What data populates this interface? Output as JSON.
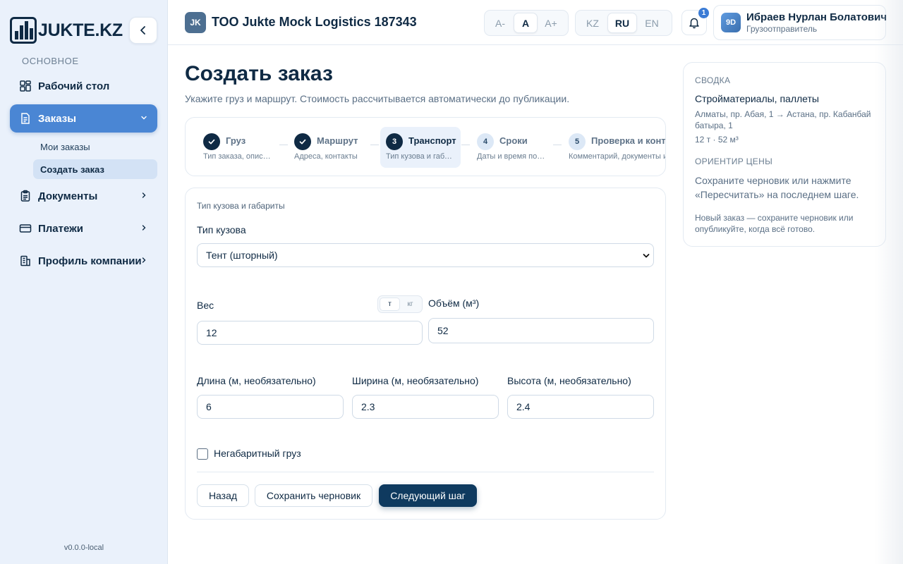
{
  "brand": {
    "logo_text": "JUKTE.KZ"
  },
  "sidebar": {
    "section_label": "ОСНОВНОЕ",
    "items": [
      {
        "label": "Рабочий стол",
        "icon": "dashboard-icon"
      },
      {
        "label": "Заказы",
        "icon": "document-icon",
        "active": true
      },
      {
        "label": "Документы",
        "icon": "clipboard-icon"
      },
      {
        "label": "Платежи",
        "icon": "card-icon"
      },
      {
        "label": "Профиль компании",
        "icon": "building-icon"
      }
    ],
    "sub_items": [
      {
        "label": "Мои заказы"
      },
      {
        "label": "Создать заказ",
        "active": true
      }
    ],
    "version": "v0.0.0-local"
  },
  "header": {
    "company_badge": "JK",
    "company_name": "ТОО Jukte Mock Logistics 187343",
    "font_size": [
      "A-",
      "A",
      "A+"
    ],
    "font_size_selected": "A",
    "languages": [
      "KZ",
      "RU",
      "EN"
    ],
    "language_selected": "RU",
    "notifications_count": "1",
    "user": {
      "initials": "9D",
      "name": "Ибраев Нурлан Болатович",
      "role": "Грузоотправитель"
    }
  },
  "page": {
    "title": "Создать заказ",
    "subtitle": "Укажите груз и маршрут. Стоимость рассчитывается автоматически до публикации."
  },
  "steps": [
    {
      "num": "1",
      "title": "Груз",
      "desc": "Тип заказа, описание",
      "status": "done"
    },
    {
      "num": "2",
      "title": "Маршрут",
      "desc": "Адреса, контакты",
      "status": "done"
    },
    {
      "num": "3",
      "title": "Транспорт",
      "desc": "Тип кузова и габариты",
      "status": "current"
    },
    {
      "num": "4",
      "title": "Сроки",
      "desc": "Даты и время погрузки",
      "status": "todo"
    },
    {
      "num": "5",
      "title": "Проверка и контакты",
      "desc": "Комментарий, документы и",
      "status": "todo"
    }
  ],
  "form": {
    "section_title": "Тип кузова и габариты",
    "body_type_label": "Тип кузова",
    "body_type_value": "Тент (шторный)",
    "weight_label": "Вес",
    "weight_units": [
      "т",
      "кг"
    ],
    "weight_unit_selected": "т",
    "weight_value": "12",
    "volume_label": "Объём (м³)",
    "volume_value": "52",
    "length_label": "Длина (м, необязательно)",
    "length_value": "6",
    "width_label": "Ширина (м, необязательно)",
    "width_value": "2.3",
    "height_label": "Высота (м, необязательно)",
    "height_value": "2.4",
    "oversize_label": "Негабаритный груз",
    "oversize_checked": false,
    "buttons": {
      "back": "Назад",
      "save_draft": "Сохранить черновик",
      "next": "Следующий шаг"
    }
  },
  "summary": {
    "heading": "СВОДКА",
    "cargo": "Стройматериалы, паллеты",
    "route": "Алматы, пр. Абая, 1 → Астана, пр. Кабанбай батыра, 1",
    "specs": "12 т · 52 м³",
    "price_heading": "ОРИЕНТИР ЦЕНЫ",
    "price_text": "Сохраните черновик или нажмите «Пересчитать» на последнем шаге.",
    "note": "Новый заказ — сохраните черновик или опубликуйте, когда всё готово."
  },
  "colors": {
    "primary": "#0f2a44",
    "accent": "#4a86d4",
    "sidebar_bg": "#eaf1fb"
  }
}
